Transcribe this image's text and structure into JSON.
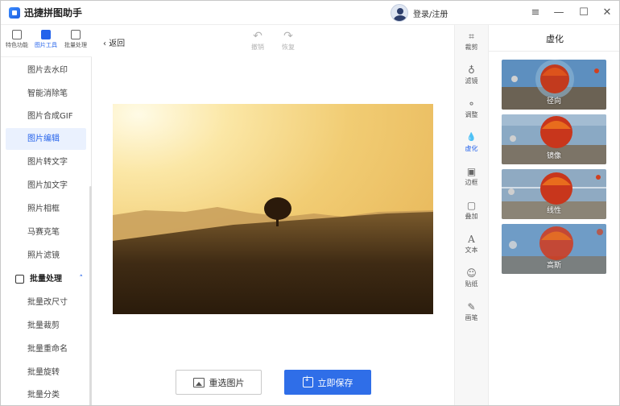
{
  "app": {
    "title": "迅捷拼图助手",
    "user_label": "登录/注册",
    "window_controls": [
      "≡",
      "—",
      "☐",
      "✕"
    ]
  },
  "tool_tabs": [
    {
      "label": "特色功能",
      "icon": "grid-icon",
      "active": false
    },
    {
      "label": "图片工具",
      "icon": "image-tool-icon",
      "active": true
    },
    {
      "label": "批量处理",
      "icon": "batch-icon",
      "active": false
    }
  ],
  "menu": {
    "items_top": [
      {
        "label": "图片去水印",
        "active": false
      },
      {
        "label": "智能消除笔",
        "active": false
      },
      {
        "label": "图片合成GIF",
        "active": false
      },
      {
        "label": "图片编辑",
        "active": true
      },
      {
        "label": "图片转文字",
        "active": false
      },
      {
        "label": "图片加文字",
        "active": false
      },
      {
        "label": "照片相框",
        "active": false
      },
      {
        "label": "马赛克笔",
        "active": false
      },
      {
        "label": "照片滤镜",
        "active": false
      }
    ],
    "section": {
      "label": "批量处理",
      "expanded_glyph": "˄"
    },
    "items_bottom": [
      {
        "label": "批量改尺寸"
      },
      {
        "label": "批量裁剪"
      },
      {
        "label": "批量重命名"
      },
      {
        "label": "批量旋转"
      },
      {
        "label": "批量分类"
      }
    ]
  },
  "editor": {
    "back_label": "返回",
    "undo_label": "撤销",
    "redo_label": "恢复",
    "reselect_label": "重选图片",
    "save_label": "立即保存"
  },
  "tools": [
    {
      "label": "裁剪",
      "icon": "crop-icon",
      "glyph": "⌗",
      "active": false
    },
    {
      "label": "滤镜",
      "icon": "filter-icon",
      "glyph": "♁",
      "active": false
    },
    {
      "label": "调整",
      "icon": "adjust-icon",
      "glyph": "⚬",
      "active": false
    },
    {
      "label": "虚化",
      "icon": "blur-drop-icon",
      "glyph": "💧",
      "active": true
    },
    {
      "label": "边框",
      "icon": "border-icon",
      "glyph": "▣",
      "active": false
    },
    {
      "label": "叠加",
      "icon": "overlay-icon",
      "glyph": "▢",
      "active": false
    },
    {
      "label": "文本",
      "icon": "text-icon",
      "glyph": "A",
      "active": false
    },
    {
      "label": "贴纸",
      "icon": "sticker-icon",
      "glyph": "☺",
      "active": false
    },
    {
      "label": "画笔",
      "icon": "brush-icon",
      "glyph": "✎",
      "active": false
    }
  ],
  "panel": {
    "title": "虚化",
    "options": [
      {
        "label": "径向"
      },
      {
        "label": "镜像"
      },
      {
        "label": "线性"
      },
      {
        "label": "高斯"
      }
    ]
  },
  "colors": {
    "accent": "#2563eb",
    "save_button": "#2f6ee8"
  }
}
